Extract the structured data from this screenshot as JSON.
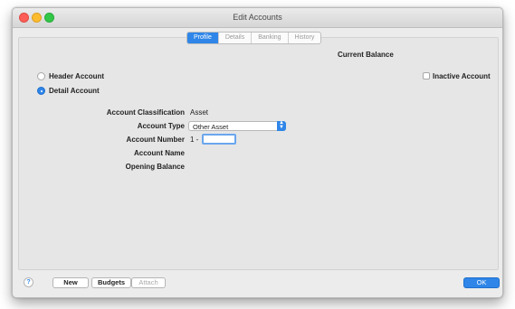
{
  "window": {
    "title": "Edit Accounts"
  },
  "tabs": [
    {
      "label": "Profile",
      "active": true
    },
    {
      "label": "Details",
      "active": false
    },
    {
      "label": "Banking",
      "active": false
    },
    {
      "label": "History",
      "active": false
    }
  ],
  "header": {
    "current_balance_label": "Current Balance"
  },
  "account_kind": {
    "header_label": "Header Account",
    "detail_label": "Detail Account",
    "selected": "Detail Account"
  },
  "inactive": {
    "label": "Inactive Account",
    "checked": false
  },
  "form": {
    "classification_label": "Account Classification",
    "classification_value": "Asset",
    "type_label": "Account Type",
    "type_value": "Other Asset",
    "number_label": "Account Number",
    "number_prefix": "1 -",
    "number_value": "",
    "name_label": "Account Name",
    "opening_balance_label": "Opening Balance"
  },
  "footer": {
    "help_glyph": "?",
    "new_label": "New",
    "budgets_label": "Budgets",
    "attach_label": "Attach",
    "ok_label": "OK"
  },
  "colors": {
    "accent": "#2f86e8"
  }
}
